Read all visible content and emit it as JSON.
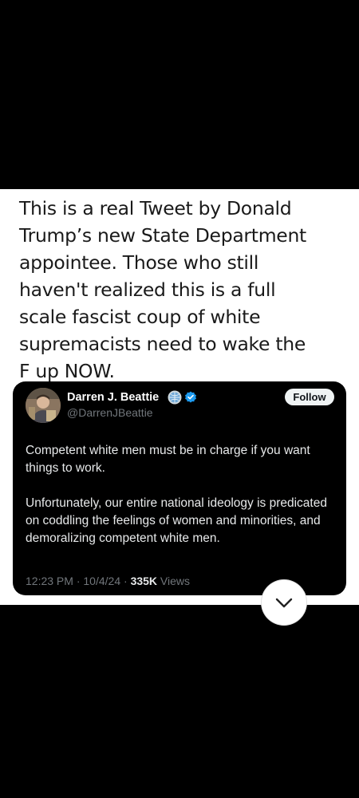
{
  "post": {
    "headline_lines": [
      "This is a real Tweet by Donald",
      "Trump’s new State Department",
      "appointee. Those who still",
      "haven't realized this is a full",
      "scale fascist coup of white",
      "supremacists need to wake the",
      "F up NOW."
    ]
  },
  "tweet": {
    "display_name": "Darren J. Beattie",
    "handle": "@DarrenJBeattie",
    "follow_label": "Follow",
    "paragraphs": [
      "Competent white men must be in charge if you want things to work.",
      "Unfortunately, our entire national ideology is predicated on coddling the feelings of women and minorities, and demoralizing competent white men."
    ],
    "time": "12:23 PM",
    "date": "10/4/24",
    "views_count": "335K",
    "views_label": "Views",
    "separator": " · "
  },
  "icons": {
    "globe": "globe-badge-icon",
    "verified": "verified-check-icon",
    "expand": "chevron-down-icon"
  },
  "colors": {
    "page_background": "#000000",
    "panel_background": "#ffffff",
    "tweet_background": "#000000",
    "verified_blue": "#1d9bf0",
    "muted_text": "#71767b"
  }
}
